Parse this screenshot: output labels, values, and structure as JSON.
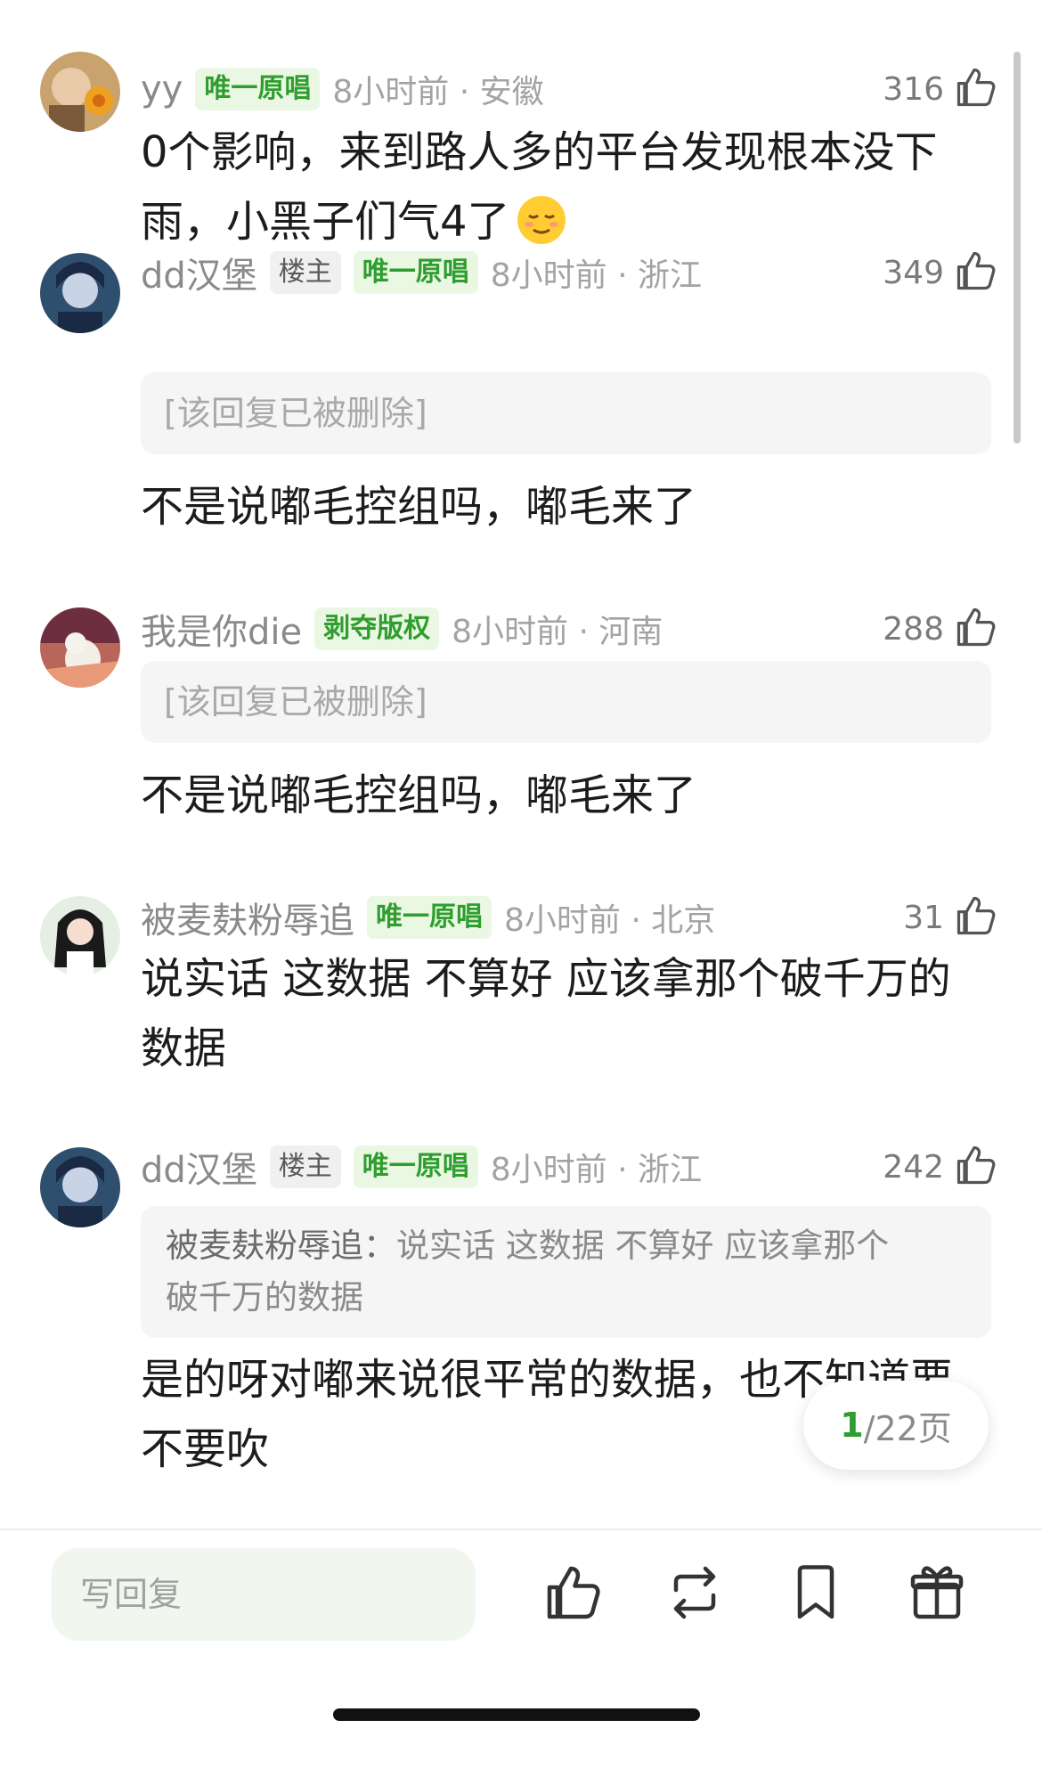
{
  "comments": [
    {
      "name": "yy",
      "tags": [
        "唯一原唱"
      ],
      "time": "8小时前 · 安徽",
      "likes": "316",
      "content_line1": "0个影响，来到路人多的平台发现根本没下",
      "content_line2": "雨，小黑子们气4了"
    },
    {
      "name": "dd汉堡",
      "tags": [
        "楼主",
        "唯一原唱"
      ],
      "time": "8小时前 · 浙江",
      "likes": "349",
      "deleted": "[该回复已被删除]",
      "content": "不是说嘟毛控组吗，嘟毛来了"
    },
    {
      "name": "我是你die",
      "tags": [
        "剥夺版权"
      ],
      "time": "8小时前 · 河南",
      "likes": "288",
      "deleted": "[该回复已被删除]",
      "content": "不是说嘟毛控组吗，嘟毛来了"
    },
    {
      "name": "被麦麸粉辱追",
      "tags": [
        "唯一原唱"
      ],
      "time": "8小时前 · 北京",
      "likes": "31",
      "content_line1": "说实话 这数据 不算好 应该拿那个破千万的",
      "content_line2": "数据"
    },
    {
      "name": "dd汉堡",
      "tags": [
        "楼主",
        "唯一原唱"
      ],
      "time": "8小时前 · 浙江",
      "likes": "242",
      "quote_name": "被麦麸粉辱追：",
      "quote_line1": "说实话 这数据 不算好 应该拿那个",
      "quote_line2": "破千万的数据",
      "content_line1": "是的呀对嘟来说很平常的数据，也不知道要",
      "content_line2": "不要吹"
    }
  ],
  "pager": {
    "current": "1",
    "total": "/22页"
  },
  "bottom_bar": {
    "reply_placeholder": "写回复",
    "icons": [
      "like-icon",
      "repost-icon",
      "bookmark-icon",
      "gift-icon"
    ]
  },
  "colors": {
    "accent_green": "#2f9e2f",
    "tag_bg": "#e9f7e3"
  }
}
